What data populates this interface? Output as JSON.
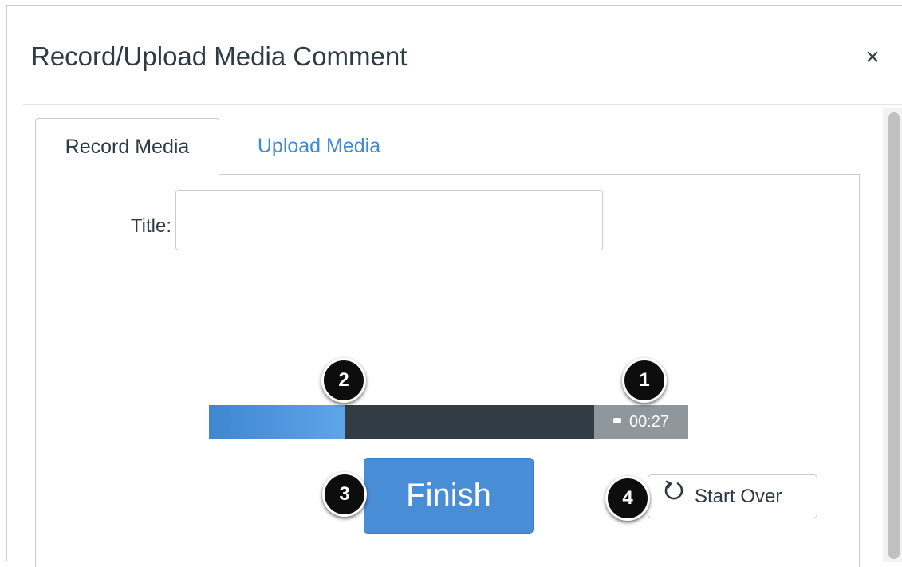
{
  "dialog": {
    "title": "Record/Upload Media Comment",
    "close_label": "×"
  },
  "tabs": [
    {
      "label": "Record Media",
      "active": true
    },
    {
      "label": "Upload Media",
      "active": false
    }
  ],
  "form": {
    "title_label": "Title:",
    "title_value": "",
    "title_placeholder": ""
  },
  "recorder": {
    "progress_fraction": 0.285,
    "elapsed_time": "00:27",
    "finish_label": "Finish",
    "start_over_label": "Start Over"
  },
  "callouts": [
    "1",
    "2",
    "3",
    "4"
  ],
  "icons": {
    "close": "close-icon",
    "recording": "recording-indicator-icon",
    "start_over": "refresh-icon"
  },
  "colors": {
    "accent": "#4a8dd7",
    "link": "#3d8ad6",
    "progress_track": "#323c45",
    "timer_bg": "#8f969c",
    "text": "#2d3b45"
  }
}
